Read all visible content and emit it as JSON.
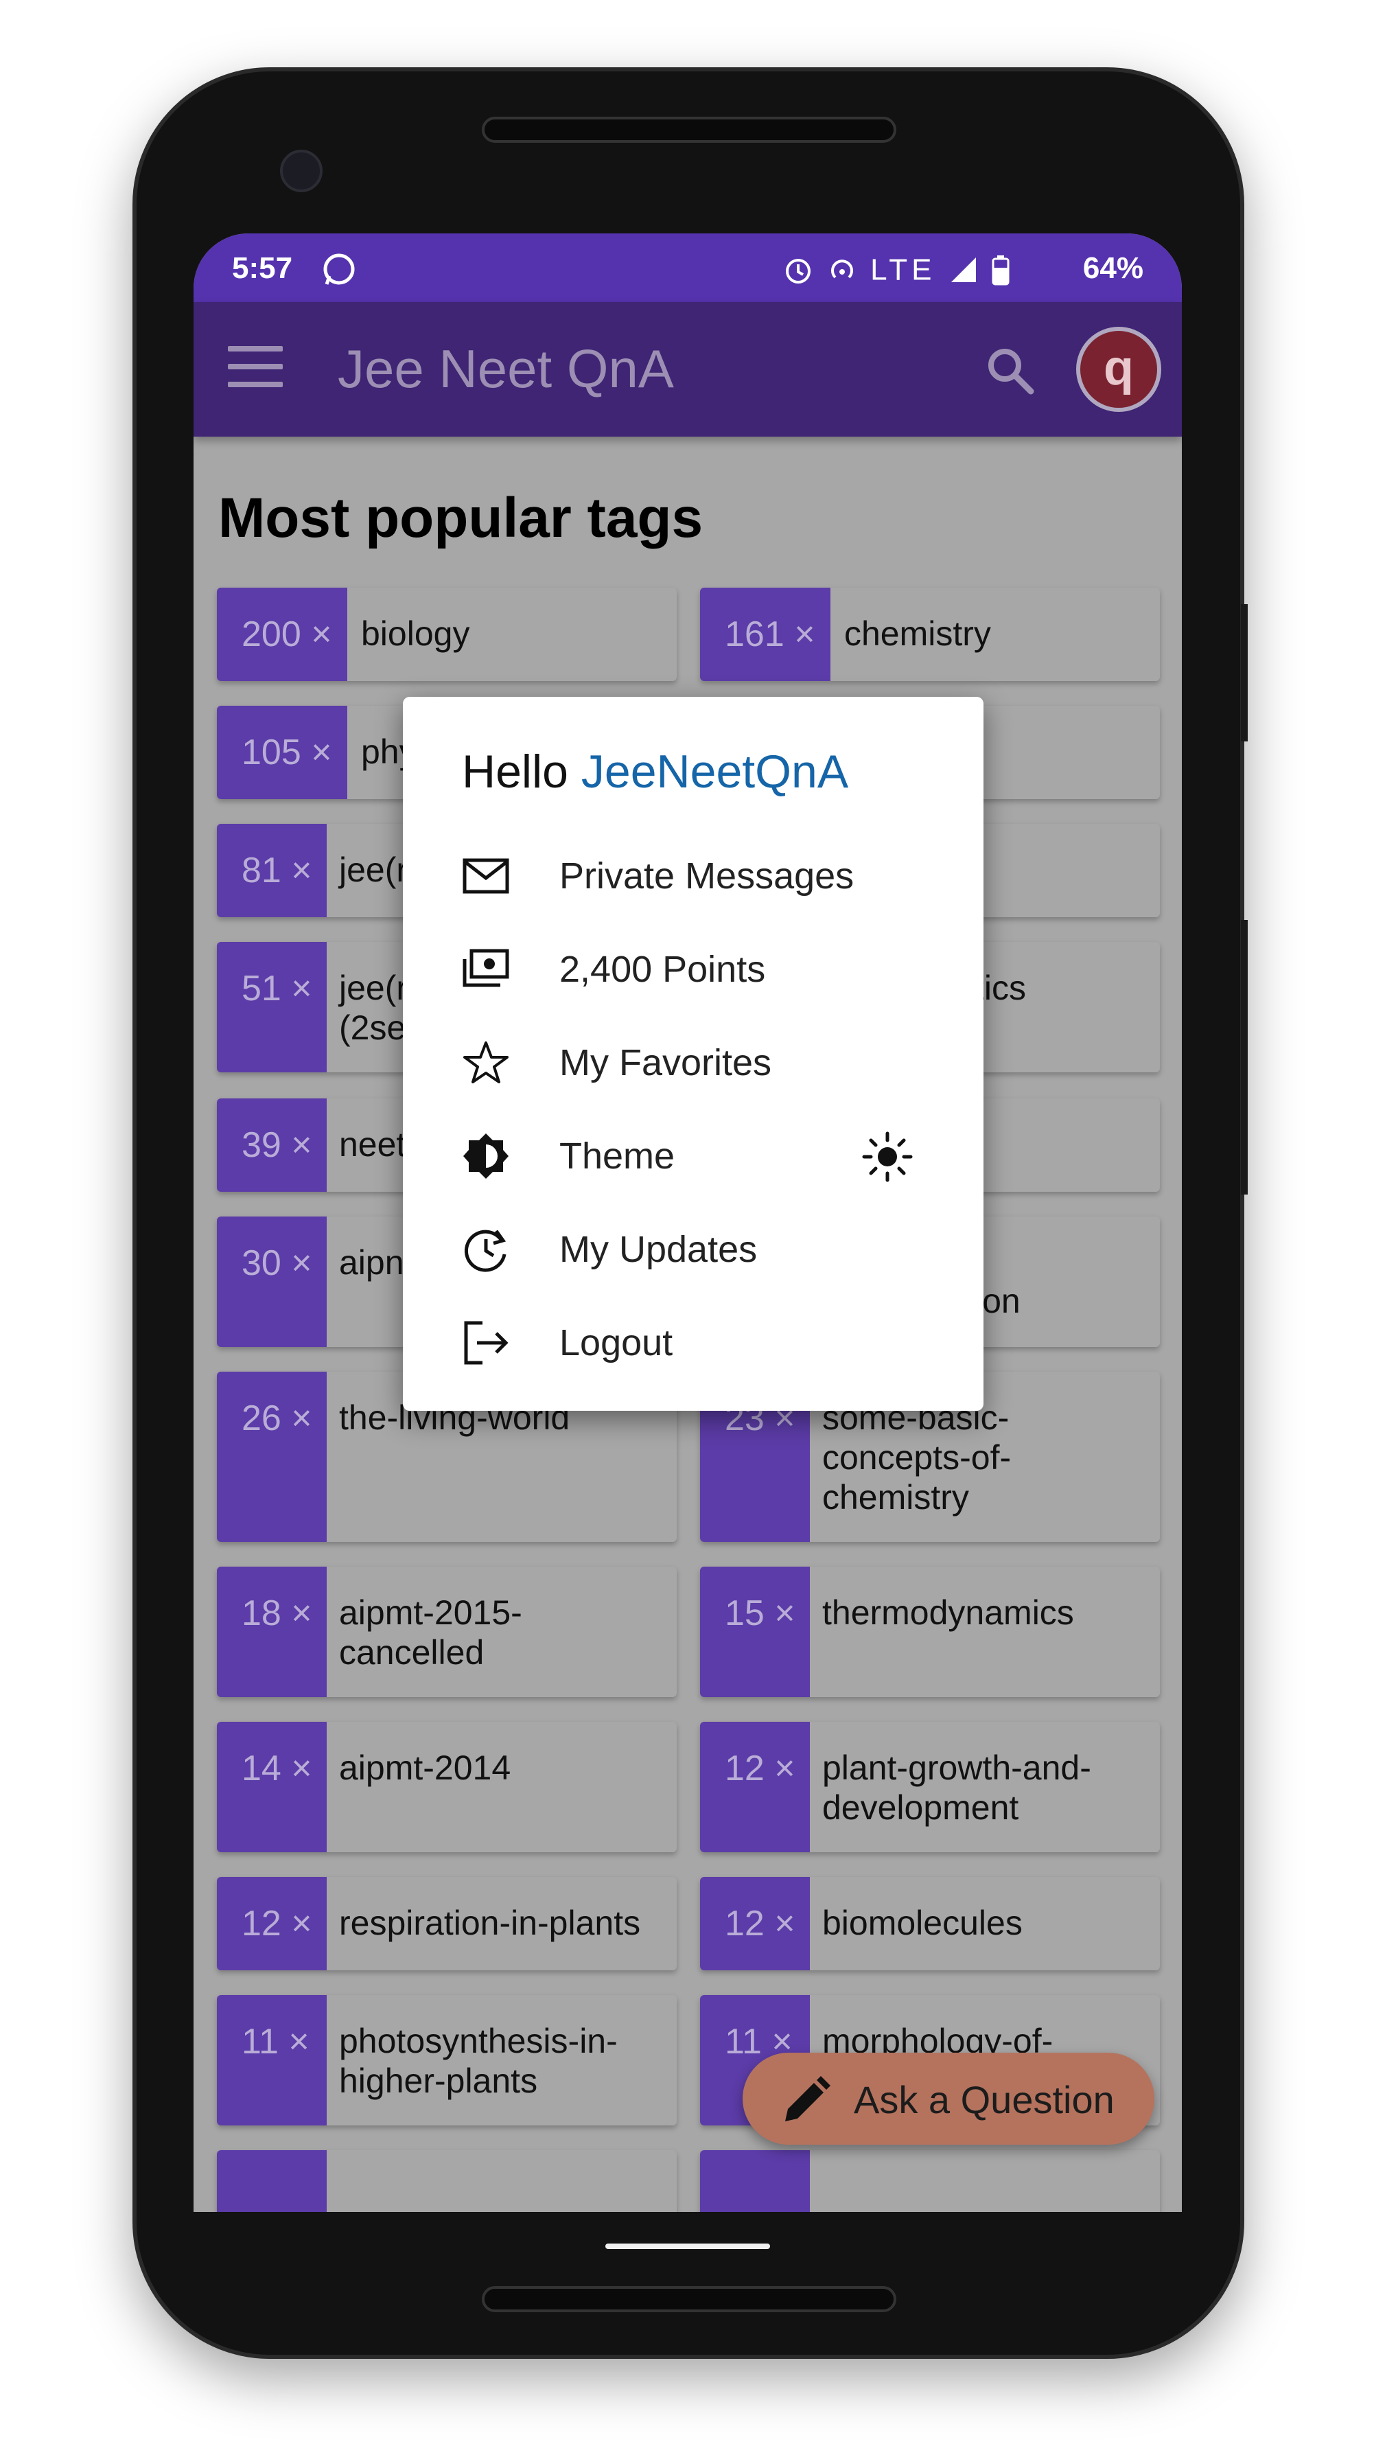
{
  "status": {
    "time": "5:57",
    "network": "LTE",
    "battery": "64%"
  },
  "appbar": {
    "title": "Jee Neet QnA",
    "avatar_letter": "q"
  },
  "page": {
    "heading": "Most popular tags"
  },
  "tags": [
    {
      "count": "200 ×",
      "name": "biology"
    },
    {
      "count": "161 ×",
      "name": "chemistry"
    },
    {
      "count": "105 ×",
      "name": "phy"
    },
    {
      "count": "81 ×",
      "name": "jee(r"
    },
    {
      "count": "51 ×",
      "name": "jee(r (2se"
    },
    {
      "count": "",
      "name": "tics"
    },
    {
      "count": "39 ×",
      "name": "neet"
    },
    {
      "count": "30 ×",
      "name": "aipn"
    },
    {
      "count": "",
      "name": "ion"
    },
    {
      "count": "26 ×",
      "name": "the-living-world"
    },
    {
      "count": "23 ×",
      "name": "some-basic-concepts-of-chemistry"
    },
    {
      "count": "18 ×",
      "name": "aipmt-2015-cancelled"
    },
    {
      "count": "15 ×",
      "name": "thermodynamics"
    },
    {
      "count": "14 ×",
      "name": "aipmt-2014"
    },
    {
      "count": "12 ×",
      "name": "plant-growth-and-development"
    },
    {
      "count": "12 ×",
      "name": "respiration-in-plants"
    },
    {
      "count": "12 ×",
      "name": "biomolecules"
    },
    {
      "count": "11 ×",
      "name": "photosynthesis-in-higher-plants"
    },
    {
      "count": "11 ×",
      "name": "morphology-of-"
    }
  ],
  "dialog": {
    "hello": "Hello",
    "username": "JeeNeetQnA",
    "items": [
      {
        "label": "Private Messages",
        "icon": "mail-icon"
      },
      {
        "label": "2,400 Points",
        "icon": "cash-icon"
      },
      {
        "label": "My Favorites",
        "icon": "star-icon"
      },
      {
        "label": "Theme",
        "icon": "theme-icon"
      },
      {
        "label": "My Updates",
        "icon": "history-icon"
      },
      {
        "label": "Logout",
        "icon": "logout-icon"
      }
    ]
  },
  "fab": {
    "label": "Ask a Question"
  }
}
